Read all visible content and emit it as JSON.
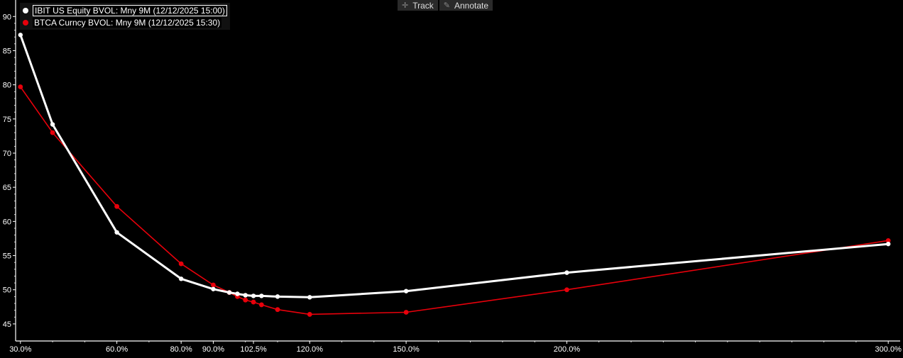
{
  "toolbar": {
    "track_label": "Track",
    "annotate_label": "Annotate",
    "track_icon": "crosshair-icon",
    "annotate_icon": "pencil-icon"
  },
  "legend": [
    {
      "label": "IBIT US Equity BVOL: Mny 9M (12/12/2025 15:00)",
      "color": "#ffffff"
    },
    {
      "label": "BTCA Curncy BVOL: Mny 9M (12/12/2025 15:30)",
      "color": "#e8000b"
    }
  ],
  "colors": {
    "background": "#000000",
    "axis": "#ffffff",
    "ibit": "#ffffff",
    "btca": "#e8000b"
  },
  "chart_data": {
    "type": "line",
    "xlabel": "",
    "ylabel": "",
    "xlim": [
      28.5,
      301.5
    ],
    "ylim": [
      42.5,
      92
    ],
    "x_ticks": [
      {
        "value": 30,
        "label": "30.0%"
      },
      {
        "value": 60,
        "label": "60.0%"
      },
      {
        "value": 80,
        "label": "80.0%"
      },
      {
        "value": 90,
        "label": "90.0%"
      },
      {
        "value": 102.5,
        "label": "102.5%"
      },
      {
        "value": 120,
        "label": "120.0%"
      },
      {
        "value": 150,
        "label": "150.0%"
      },
      {
        "value": 200,
        "label": "200.0%"
      },
      {
        "value": 300,
        "label": "300.0%"
      }
    ],
    "y_ticks": [
      45,
      50,
      55,
      60,
      65,
      70,
      75,
      80,
      85,
      90
    ],
    "series": [
      {
        "name": "IBIT US Equity BVOL: Mny 9M (12/12/2025 15:00)",
        "x": [
          30,
          40,
          60,
          80,
          90,
          95,
          97.5,
          100,
          102.5,
          105,
          110,
          120,
          150,
          200,
          300
        ],
        "y": [
          87.3,
          74.2,
          58.4,
          51.6,
          50.1,
          49.6,
          49.4,
          49.2,
          49.1,
          49.1,
          49.0,
          48.9,
          49.8,
          52.5,
          56.7
        ]
      },
      {
        "name": "BTCA Curncy BVOL: Mny 9M (12/12/2025 15:30)",
        "x": [
          30,
          40,
          60,
          80,
          90,
          95,
          97.5,
          100,
          102.5,
          105,
          110,
          120,
          150,
          200,
          300
        ],
        "y": [
          79.7,
          73.0,
          62.2,
          53.8,
          50.7,
          49.6,
          49.0,
          48.5,
          48.2,
          47.8,
          47.1,
          46.4,
          46.7,
          50.0,
          57.2
        ]
      }
    ]
  }
}
